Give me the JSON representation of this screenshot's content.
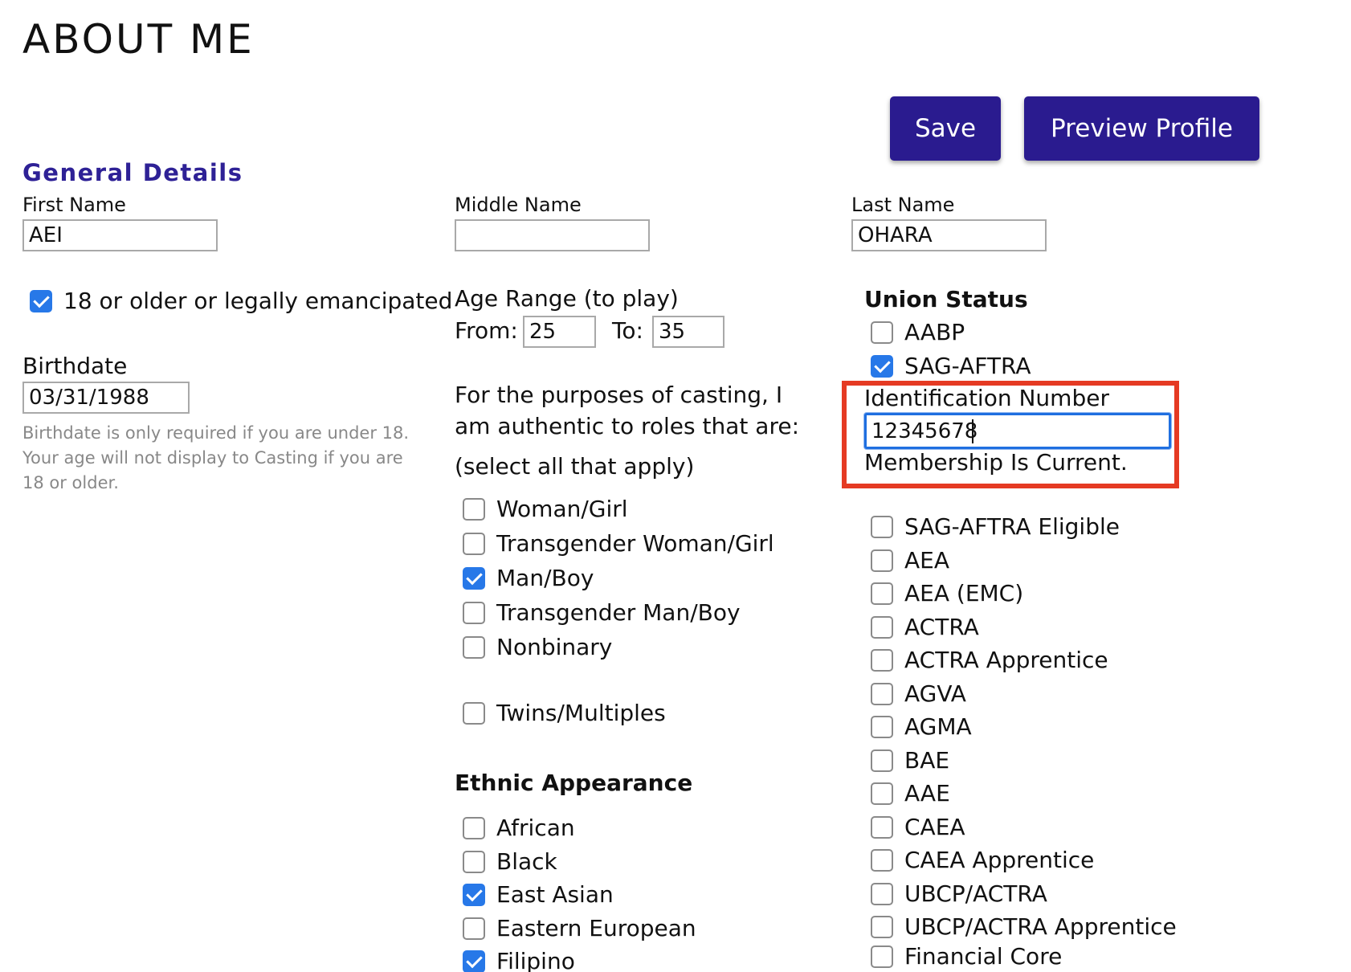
{
  "page_title": "ABOUT ME",
  "actions": {
    "save_label": "Save",
    "preview_label": "Preview Profile"
  },
  "section_title": "General Details",
  "name": {
    "first_label": "First Name",
    "first_value": "AEI",
    "middle_label": "Middle Name",
    "middle_value": "",
    "last_label": "Last Name",
    "last_value": "OHARA"
  },
  "legal_age": {
    "label": "18 or older or legally emancipated",
    "checked": true
  },
  "birthdate": {
    "label": "Birthdate",
    "value": "03/31/1988",
    "helper": "Birthdate is only required if you are under 18. Your age will not display to Casting if you are 18 or older."
  },
  "age_range": {
    "label": "Age Range (to play)",
    "from_label": "From:",
    "from_value": "25",
    "to_label": "To:",
    "to_value": "35"
  },
  "casting": {
    "line1": "For the purposes of casting, I",
    "line2": "am authentic to roles that are:",
    "line3": "(select all that apply)",
    "options": [
      {
        "label": "Woman/Girl",
        "checked": false
      },
      {
        "label": "Transgender Woman/Girl",
        "checked": false
      },
      {
        "label": "Man/Boy",
        "checked": true
      },
      {
        "label": "Transgender Man/Boy",
        "checked": false
      },
      {
        "label": "Nonbinary",
        "checked": false
      }
    ],
    "twins": {
      "label": "Twins/Multiples",
      "checked": false
    }
  },
  "ethnic": {
    "heading": "Ethnic Appearance",
    "options": [
      {
        "label": "African",
        "checked": false
      },
      {
        "label": "Black",
        "checked": false
      },
      {
        "label": "East Asian",
        "checked": true
      },
      {
        "label": "Eastern European",
        "checked": false
      },
      {
        "label": "Filipino",
        "checked": true
      }
    ]
  },
  "union": {
    "heading": "Union Status",
    "top_options": [
      {
        "label": "AABP",
        "checked": false
      },
      {
        "label": "SAG-AFTRA",
        "checked": true
      }
    ],
    "id_label": "Identification Number",
    "id_value": "12345678",
    "membership_status": "Membership Is Current.",
    "options": [
      {
        "label": "SAG-AFTRA Eligible",
        "checked": false
      },
      {
        "label": "AEA",
        "checked": false
      },
      {
        "label": "AEA (EMC)",
        "checked": false
      },
      {
        "label": "ACTRA",
        "checked": false
      },
      {
        "label": "ACTRA Apprentice",
        "checked": false
      },
      {
        "label": "AGVA",
        "checked": false
      },
      {
        "label": "AGMA",
        "checked": false
      },
      {
        "label": "BAE",
        "checked": false
      },
      {
        "label": "AAE",
        "checked": false
      },
      {
        "label": "CAEA",
        "checked": false
      },
      {
        "label": "CAEA Apprentice",
        "checked": false
      },
      {
        "label": "UBCP/ACTRA",
        "checked": false
      },
      {
        "label": "UBCP/ACTRA Apprentice",
        "checked": false
      },
      {
        "label": "Financial Core",
        "checked": false
      }
    ]
  },
  "colors": {
    "button_bg": "#2a1b8f",
    "section_title": "#2e2196",
    "checkbox_checked": "#2778e8",
    "highlight_border": "#e53a23",
    "focus_border": "#1f6fe0"
  }
}
